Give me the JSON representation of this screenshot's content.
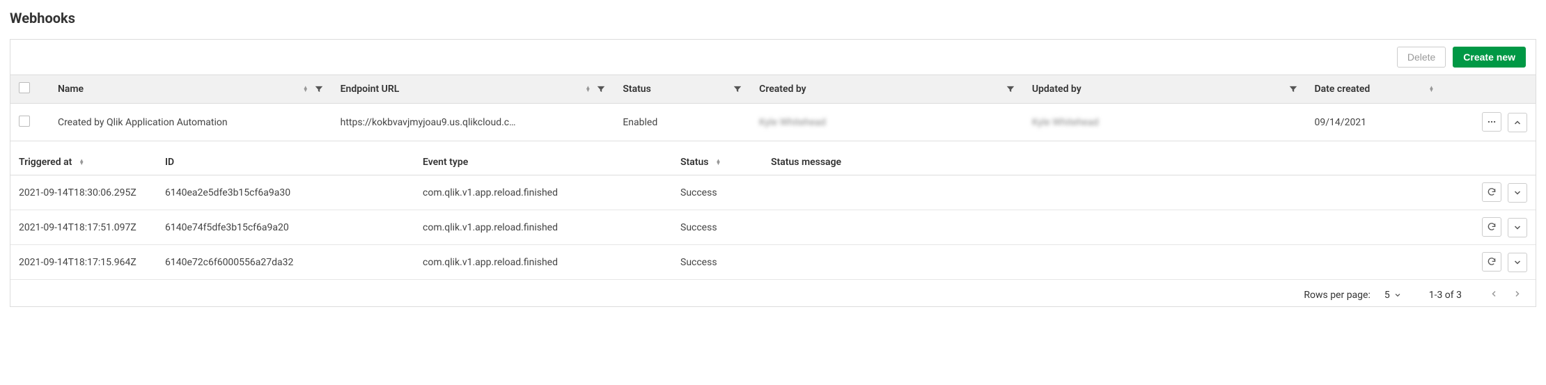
{
  "pageTitle": "Webhooks",
  "actions": {
    "delete": "Delete",
    "create": "Create new"
  },
  "mainTable": {
    "columns": {
      "name": "Name",
      "endpoint": "Endpoint URL",
      "status": "Status",
      "createdBy": "Created by",
      "updatedBy": "Updated by",
      "dateCreated": "Date created"
    },
    "rows": [
      {
        "name": "Created by Qlik Application Automation",
        "endpoint": "https://kokbvavjmyjoau9.us.qlikcloud.c…",
        "status": "Enabled",
        "createdBy": "Kyle Whitehead",
        "updatedBy": "Kyle Whitehead",
        "dateCreated": "09/14/2021"
      }
    ]
  },
  "innerTable": {
    "columns": {
      "triggeredAt": "Triggered at",
      "id": "ID",
      "eventType": "Event type",
      "status": "Status",
      "statusMsg": "Status message"
    },
    "rows": [
      {
        "triggeredAt": "2021-09-14T18:30:06.295Z",
        "id": "6140ea2e5dfe3b15cf6a9a30",
        "eventType": "com.qlik.v1.app.reload.finished",
        "status": "Success",
        "statusMsg": ""
      },
      {
        "triggeredAt": "2021-09-14T18:17:51.097Z",
        "id": "6140e74f5dfe3b15cf6a9a20",
        "eventType": "com.qlik.v1.app.reload.finished",
        "status": "Success",
        "statusMsg": ""
      },
      {
        "triggeredAt": "2021-09-14T18:17:15.964Z",
        "id": "6140e72c6f6000556a27da32",
        "eventType": "com.qlik.v1.app.reload.finished",
        "status": "Success",
        "statusMsg": ""
      }
    ]
  },
  "pager": {
    "rowsPerPageLabel": "Rows per page:",
    "rowsPerPageValue": "5",
    "rangeLabel": "1-3 of 3"
  }
}
